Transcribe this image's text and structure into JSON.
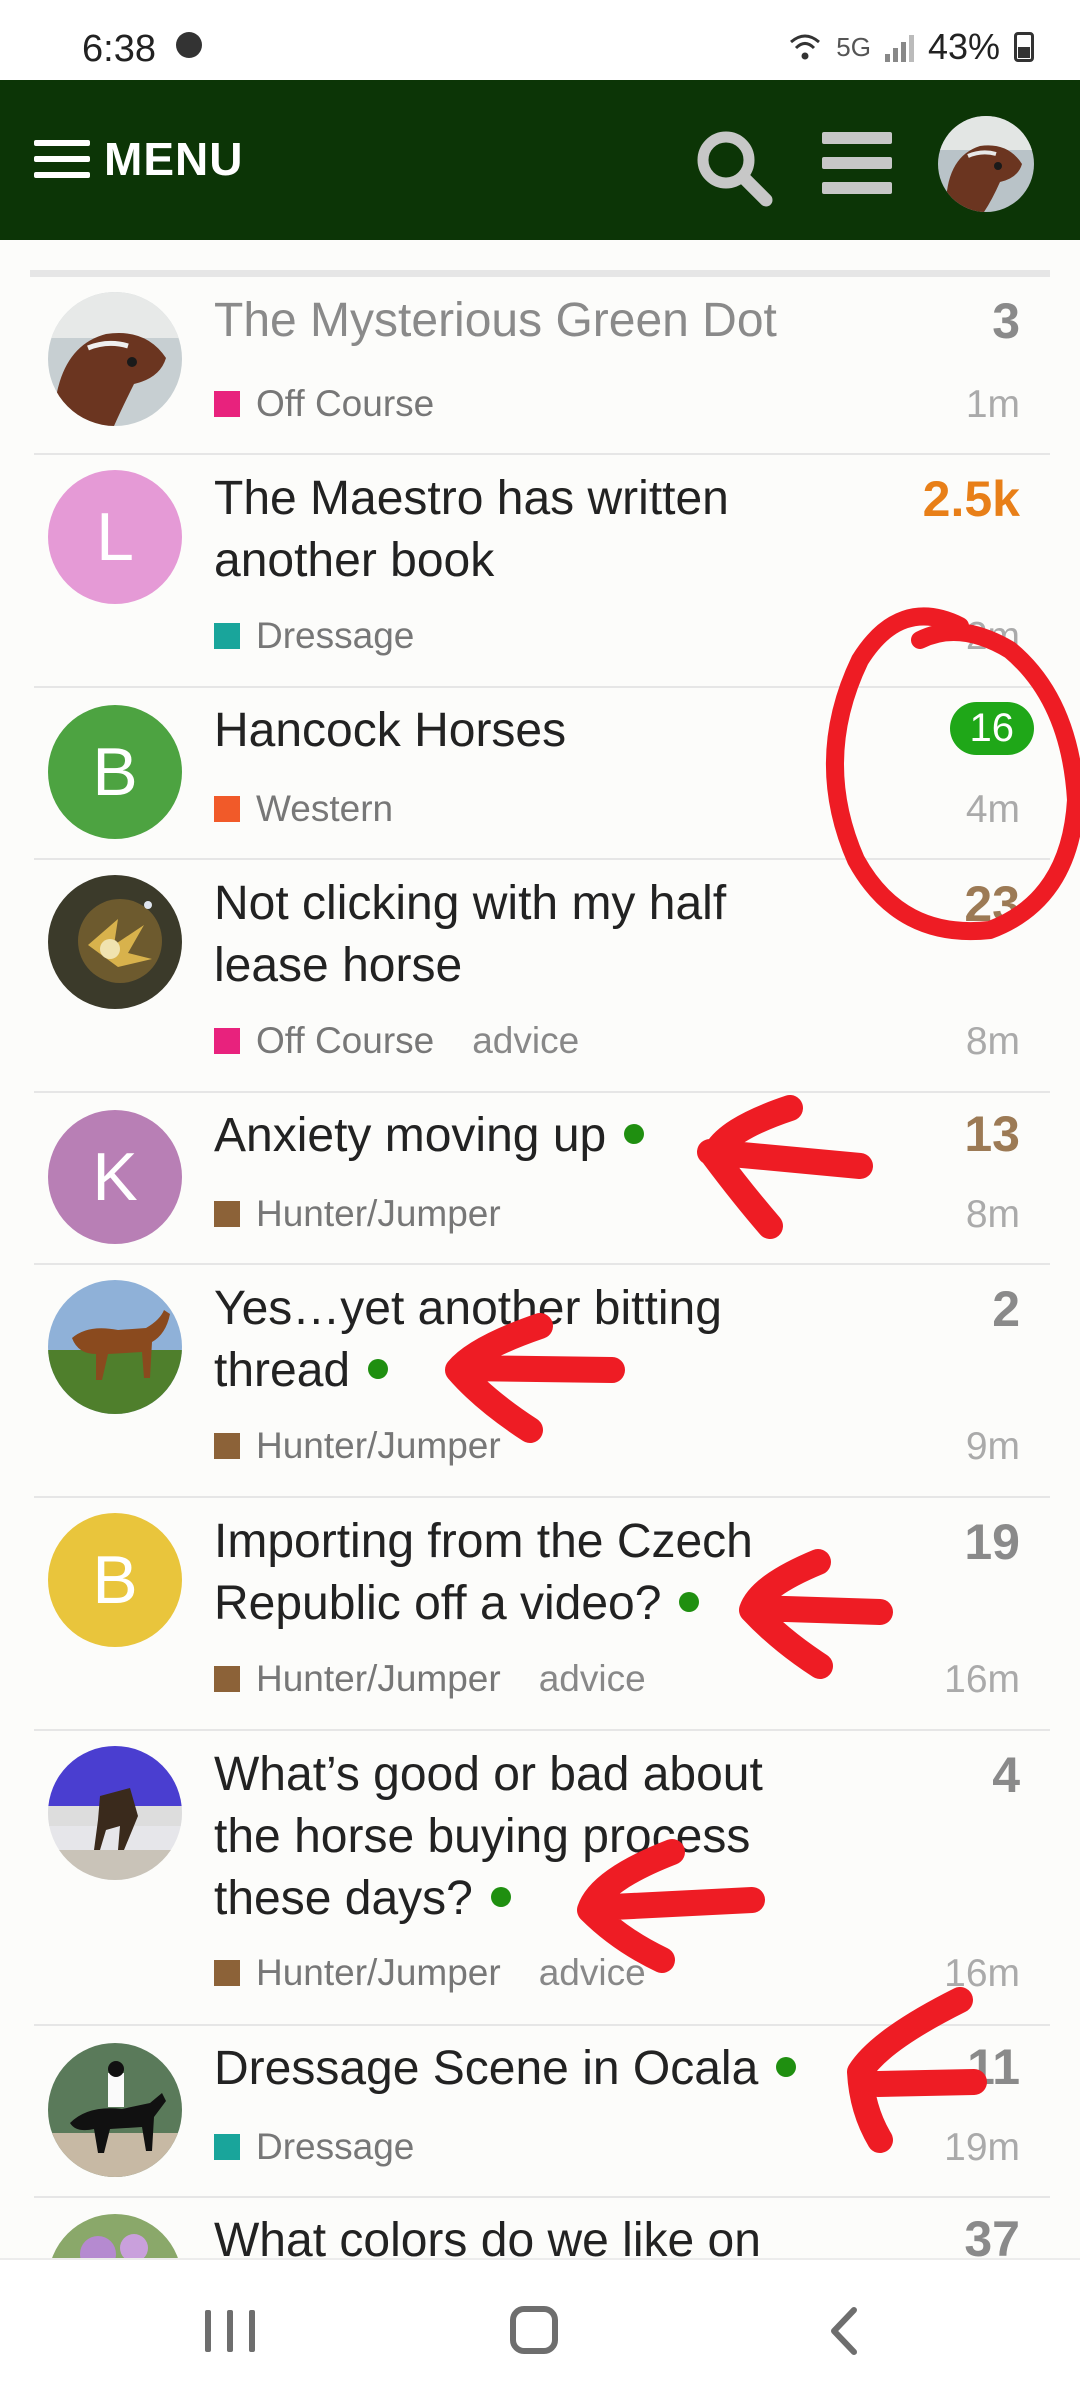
{
  "status_bar": {
    "time": "6:38",
    "network": "5G",
    "battery": "43%"
  },
  "header": {
    "menu_label": "MENU"
  },
  "topics": [
    {
      "title": "The Mysterious Green Dot",
      "category": "Off Course",
      "category_color": "#e8227d",
      "tag": "",
      "replies": "3",
      "age": "1m",
      "read": true,
      "new": false,
      "avatar_letter": "",
      "avatar_color": "#5a3a2a"
    },
    {
      "title": "The Maestro has written another book",
      "category": "Dressage",
      "category_color": "#19a59b",
      "tag": "",
      "replies": "2.5k",
      "age": "2m",
      "read": false,
      "new": false,
      "avatar_letter": "L",
      "avatar_color": "#e59ad6"
    },
    {
      "title": "Hancock Horses",
      "category": "Western",
      "category_color": "#f15a29",
      "tag": "",
      "replies": "16",
      "age": "4m",
      "read": false,
      "new": false,
      "avatar_letter": "B",
      "avatar_color": "#4da341"
    },
    {
      "title": "Not clicking with my half lease horse",
      "category": "Off Course",
      "category_color": "#e8227d",
      "tag": "advice",
      "replies": "23",
      "age": "8m",
      "read": false,
      "new": false,
      "avatar_letter": "",
      "avatar_color": "#6b5a3a"
    },
    {
      "title": "Anxiety moving up",
      "category": "Hunter/Jumper",
      "category_color": "#8c6238",
      "tag": "",
      "replies": "13",
      "age": "8m",
      "read": false,
      "new": true,
      "avatar_letter": "K",
      "avatar_color": "#b87fb5"
    },
    {
      "title": "Yes…yet another bitting thread",
      "category": "Hunter/Jumper",
      "category_color": "#8c6238",
      "tag": "",
      "replies": "2",
      "age": "9m",
      "read": false,
      "new": true,
      "avatar_letter": "",
      "avatar_color": "#6a8a4a"
    },
    {
      "title": "Importing from the Czech Republic off a video?",
      "category": "Hunter/Jumper",
      "category_color": "#8c6238",
      "tag": "advice",
      "replies": "19",
      "age": "16m",
      "read": false,
      "new": true,
      "avatar_letter": "B",
      "avatar_color": "#e9c53c"
    },
    {
      "title": "What’s good or bad about the horse buying process these days?",
      "category": "Hunter/Jumper",
      "category_color": "#8c6238",
      "tag": "advice",
      "replies": "4",
      "age": "16m",
      "read": false,
      "new": true,
      "avatar_letter": "",
      "avatar_color": "#4a4ad0"
    },
    {
      "title": "Dressage Scene in Ocala",
      "category": "Dressage",
      "category_color": "#19a59b",
      "tag": "",
      "replies": "11",
      "age": "19m",
      "read": false,
      "new": true,
      "avatar_letter": "",
      "avatar_color": "#3a4a3a"
    },
    {
      "title": "What colors do we like on",
      "category": "",
      "category_color": "",
      "tag": "",
      "replies": "37",
      "age": "",
      "read": false,
      "new": false,
      "avatar_letter": "",
      "avatar_color": "#8aa86a"
    }
  ],
  "icons": {
    "menu": "hamburger-icon",
    "search": "search-icon",
    "list": "list-icon",
    "nav_recent": "recent-apps-icon",
    "nav_home": "home-icon",
    "nav_back": "back-icon"
  }
}
